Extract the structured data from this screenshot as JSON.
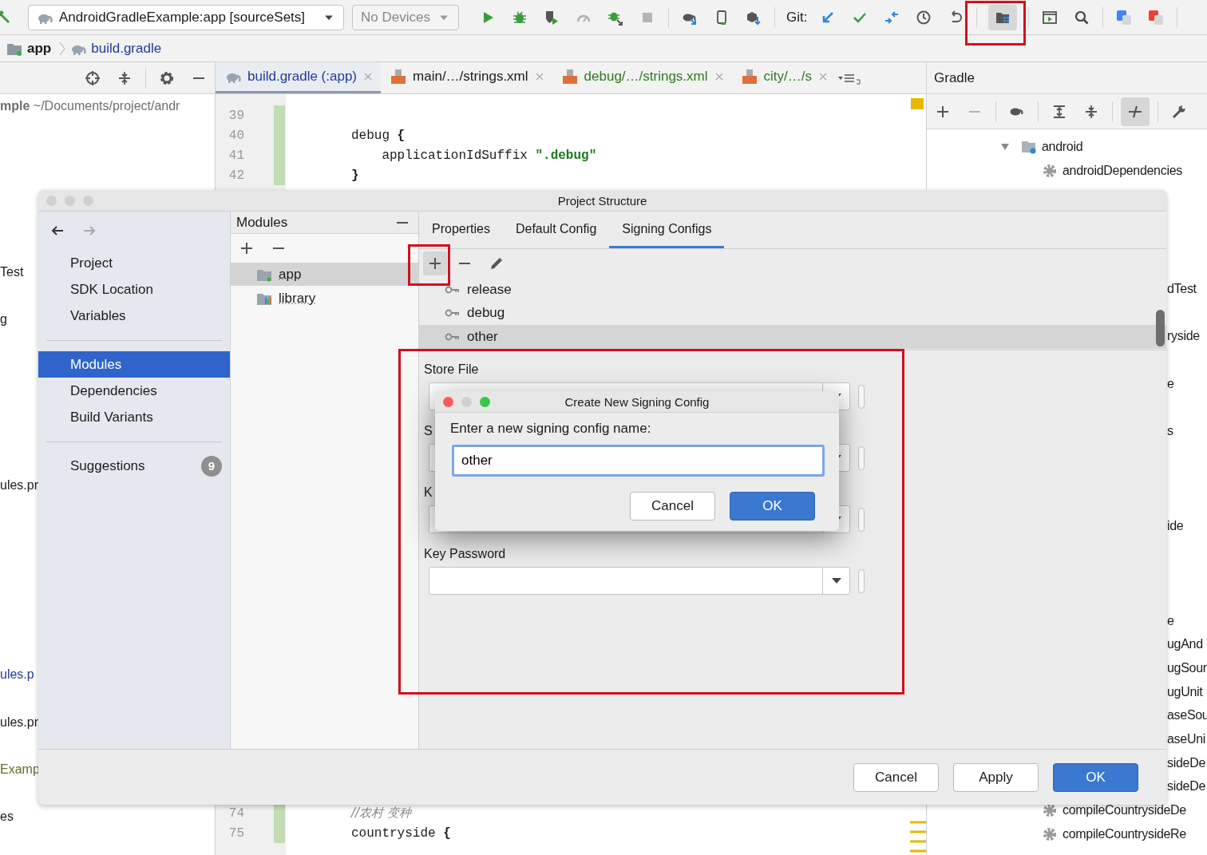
{
  "toolbar": {
    "run_config": "AndroidGradleExample:app [sourceSets]",
    "device": "No Devices",
    "git_label": "Git:"
  },
  "breadcrumb": [
    {
      "label": "app",
      "kind": "module"
    },
    {
      "label": "build.gradle",
      "kind": "file"
    }
  ],
  "project_panel": {
    "rows": [
      {
        "text": "**mple** ~/Documents/project/andr",
        "color": "#6e6e6e"
      },
      {
        "text": "Test",
        "color": "#1a1a1a"
      },
      {
        "text": "g",
        "color": "#1a1a1a"
      },
      {
        "text": "ules.pr",
        "color": "#1a1a1a"
      },
      {
        "text": "ules.p",
        "color": "#1f3c99"
      },
      {
        "text": "ules.pr",
        "color": "#1a1a1a"
      },
      {
        "text": "Examp",
        "color": "#6b6b2e"
      },
      {
        "text": "es",
        "color": "#1a1a1a"
      }
    ]
  },
  "editor_tabs": [
    {
      "label": "build.gradle (:app)",
      "kind": "gradle",
      "color": "#1f3c99",
      "selected": true
    },
    {
      "label": "main/…/strings.xml",
      "kind": "xml",
      "color": "#1a1a1a",
      "selected": false
    },
    {
      "label": "debug/…/strings.xml",
      "kind": "xml",
      "color": "#2f7a1f",
      "selected": false
    },
    {
      "label": "city/…/s",
      "kind": "xml",
      "color": "#2f7a1f",
      "selected": false
    }
  ],
  "editor": {
    "top_lines": [
      {
        "number": "39"
      },
      {
        "number": "40",
        "tokens": [
          {
            "text": "debug ",
            "kind": "plain"
          },
          {
            "text": "{",
            "kind": "bold"
          }
        ]
      },
      {
        "number": "41",
        "tokens": [
          {
            "text": "    applicationIdSuffix ",
            "kind": "plain"
          },
          {
            "text": "\".debug\"",
            "kind": "string"
          }
        ]
      },
      {
        "number": "42",
        "tokens": [
          {
            "text": "}",
            "kind": "bold"
          }
        ]
      }
    ],
    "bottom_lines": [
      {
        "number": "74",
        "tokens": [
          {
            "text": "//农村 变种",
            "kind": "comment"
          }
        ]
      },
      {
        "number": "75",
        "tokens": [
          {
            "text": "countryside ",
            "kind": "plain"
          },
          {
            "text": "{",
            "kind": "bold"
          }
        ]
      }
    ]
  },
  "gradle": {
    "title": "Gradle",
    "rows": [
      {
        "text": "android",
        "kind": "folder",
        "expanded": true
      },
      {
        "text": "androidDependencies",
        "kind": "task"
      },
      {
        "text": "dTest",
        "kind": "fragment"
      },
      {
        "text": "ryside",
        "kind": "fragment"
      },
      {
        "text": "e",
        "kind": "fragment"
      },
      {
        "text": "s",
        "kind": "fragment"
      },
      {
        "text": "ide",
        "kind": "fragment"
      },
      {
        "text": "e",
        "kind": "fragment"
      },
      {
        "text": "ugAnd",
        "kind": "fragment"
      },
      {
        "text": "ugSour",
        "kind": "fragment"
      },
      {
        "text": "ugUnit",
        "kind": "fragment"
      },
      {
        "text": "aseSou",
        "kind": "fragment"
      },
      {
        "text": "aseUni",
        "kind": "fragment"
      },
      {
        "text": "sideDe",
        "kind": "fragment"
      },
      {
        "text": "sideDe",
        "kind": "fragment"
      },
      {
        "text": "compileCountrysideDe",
        "kind": "task"
      },
      {
        "text": "compileCountrysideRe",
        "kind": "task"
      }
    ]
  },
  "project_structure": {
    "title": "Project Structure",
    "nav_groups": [
      {
        "items": [
          {
            "label": "Project",
            "selected": false
          },
          {
            "label": "SDK Location",
            "selected": false
          },
          {
            "label": "Variables",
            "selected": false
          }
        ]
      },
      {
        "items": [
          {
            "label": "Modules",
            "selected": true
          },
          {
            "label": "Dependencies",
            "selected": false
          },
          {
            "label": "Build Variants",
            "selected": false
          }
        ]
      },
      {
        "items": [
          {
            "label": "Suggestions",
            "selected": false,
            "badge": "9"
          }
        ]
      }
    ],
    "modules": {
      "title": "Modules",
      "items": [
        {
          "label": "app",
          "kind": "module",
          "selected": true
        },
        {
          "label": "library",
          "kind": "library",
          "selected": false
        }
      ]
    },
    "tabs": [
      {
        "label": "Properties",
        "selected": false
      },
      {
        "label": "Default Config",
        "selected": false
      },
      {
        "label": "Signing Configs",
        "selected": true
      }
    ],
    "signing_configs": [
      {
        "name": "release",
        "selected": false
      },
      {
        "name": "debug",
        "selected": false
      },
      {
        "name": "other",
        "selected": true
      }
    ],
    "form": [
      {
        "label": "Store File"
      },
      {
        "label": "S"
      },
      {
        "label": "K"
      },
      {
        "label": "Key Password"
      }
    ],
    "buttons": [
      {
        "label": "Cancel",
        "kind": "default"
      },
      {
        "label": "Apply",
        "kind": "default"
      },
      {
        "label": "OK",
        "kind": "primary"
      }
    ]
  },
  "new_config_dialog": {
    "title": "Create New Signing Config",
    "prompt": "Enter a new signing config name:",
    "value": "other",
    "buttons": [
      {
        "label": "Cancel",
        "kind": "default"
      },
      {
        "label": "OK",
        "kind": "primary"
      }
    ]
  }
}
